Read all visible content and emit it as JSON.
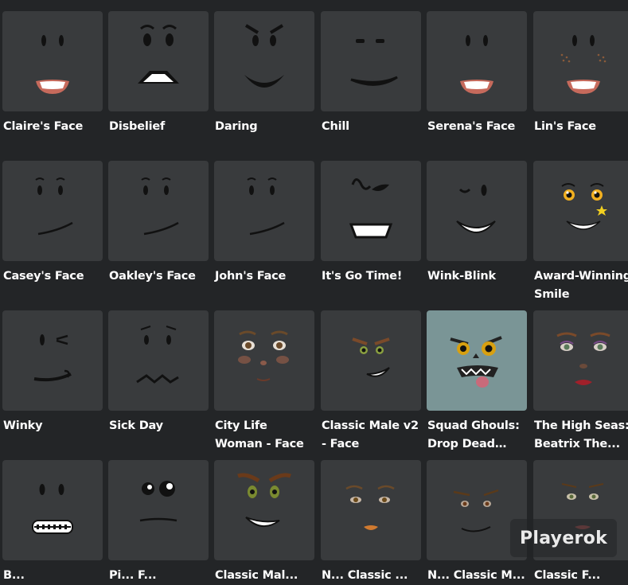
{
  "catalog": {
    "items": [
      {
        "name": "Claire's Face",
        "icon": "claires-face-icon"
      },
      {
        "name": "Disbelief",
        "icon": "disbelief-icon"
      },
      {
        "name": "Daring",
        "icon": "daring-icon"
      },
      {
        "name": "Chill",
        "icon": "chill-icon"
      },
      {
        "name": "Serena's Face",
        "icon": "serenas-face-icon"
      },
      {
        "name": "Lin's Face",
        "icon": "lins-face-icon"
      },
      {
        "name": "Casey's Face",
        "icon": "caseys-face-icon"
      },
      {
        "name": "Oakley's Face",
        "icon": "oakleys-face-icon"
      },
      {
        "name": "John's Face",
        "icon": "johns-face-icon"
      },
      {
        "name": "It's Go Time!",
        "icon": "its-go-time-icon"
      },
      {
        "name": "Wink-Blink",
        "icon": "wink-blink-icon"
      },
      {
        "name": "Award-Winning Smile",
        "icon": "award-winning-smile-icon"
      },
      {
        "name": "Winky",
        "icon": "winky-icon"
      },
      {
        "name": "Sick Day",
        "icon": "sick-day-icon"
      },
      {
        "name": "City Life Woman - Face",
        "icon": "city-life-woman-icon"
      },
      {
        "name": "Classic Male v2 - Face",
        "icon": "classic-male-v2-icon"
      },
      {
        "name": "Squad Ghouls: Drop Dead Ted...",
        "icon": "squad-ghouls-icon",
        "background": "#7a9596"
      },
      {
        "name": "The High Seas: Beatrix The...",
        "icon": "high-seas-beatrix-icon"
      },
      {
        "name": "B...",
        "icon": "braces-face-icon"
      },
      {
        "name": "Pi... F...",
        "icon": "pie-face-icon"
      },
      {
        "name": "Classic Mal...",
        "icon": "classic-male-grin-icon"
      },
      {
        "name": "N... Classic ...",
        "icon": "classic-female-icon"
      },
      {
        "name": "N... Classic M...",
        "icon": "classic-male-smirk-icon"
      },
      {
        "name": "Classic F...",
        "icon": "classic-female-alt-icon"
      }
    ]
  },
  "watermark": {
    "text": "Playerok"
  },
  "colors": {
    "page_bg": "#232527",
    "tile_bg": "#393b3d",
    "text": "#ffffff"
  }
}
